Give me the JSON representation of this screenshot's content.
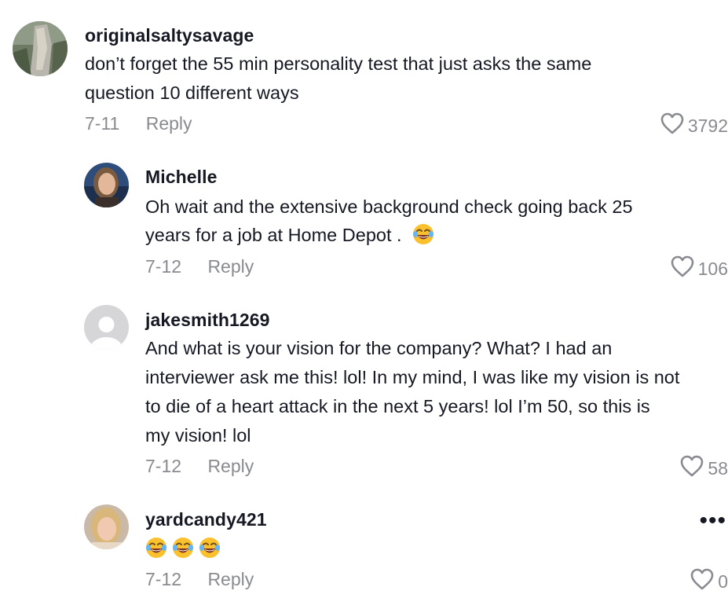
{
  "colors": {
    "text_primary": "#161823",
    "text_secondary": "#8a8b91",
    "background": "#ffffff"
  },
  "comments": [
    {
      "username": "originalsaltysavage",
      "text_lines": [
        "don’t forget the 55 min personality test that just asks the same",
        "question 10 different ways"
      ],
      "date": "7-11",
      "reply_label": "Reply",
      "likes": "3792",
      "avatar": "rocky-cliff-avatar"
    },
    {
      "username": "Michelle",
      "text_lines": [
        "Oh wait and the extensive background check going back 25",
        "years for a job at Home Depot ."
      ],
      "emoji": "laughing-tears-emoji",
      "date": "7-12",
      "reply_label": "Reply",
      "likes": "106",
      "avatar": "woman-photo-avatar"
    },
    {
      "username": "jakesmith1269",
      "text_lines": [
        "And what is your vision for the company? What? I had an",
        "interviewer ask me this! lol! In my mind, I was like my vision is not",
        "to die of a heart attack in the next 5 years! lol I’m 50, so this is",
        "my vision! lol"
      ],
      "date": "7-12",
      "reply_label": "Reply",
      "likes": "58",
      "avatar": "default-user-avatar"
    },
    {
      "username": "yardcandy421",
      "emojis": [
        "laughing-tears-emoji",
        "laughing-tears-emoji",
        "laughing-tears-emoji"
      ],
      "date": "7-12",
      "reply_label": "Reply",
      "likes": "0",
      "more_label": "•••",
      "avatar": "blonde-woman-avatar"
    }
  ]
}
